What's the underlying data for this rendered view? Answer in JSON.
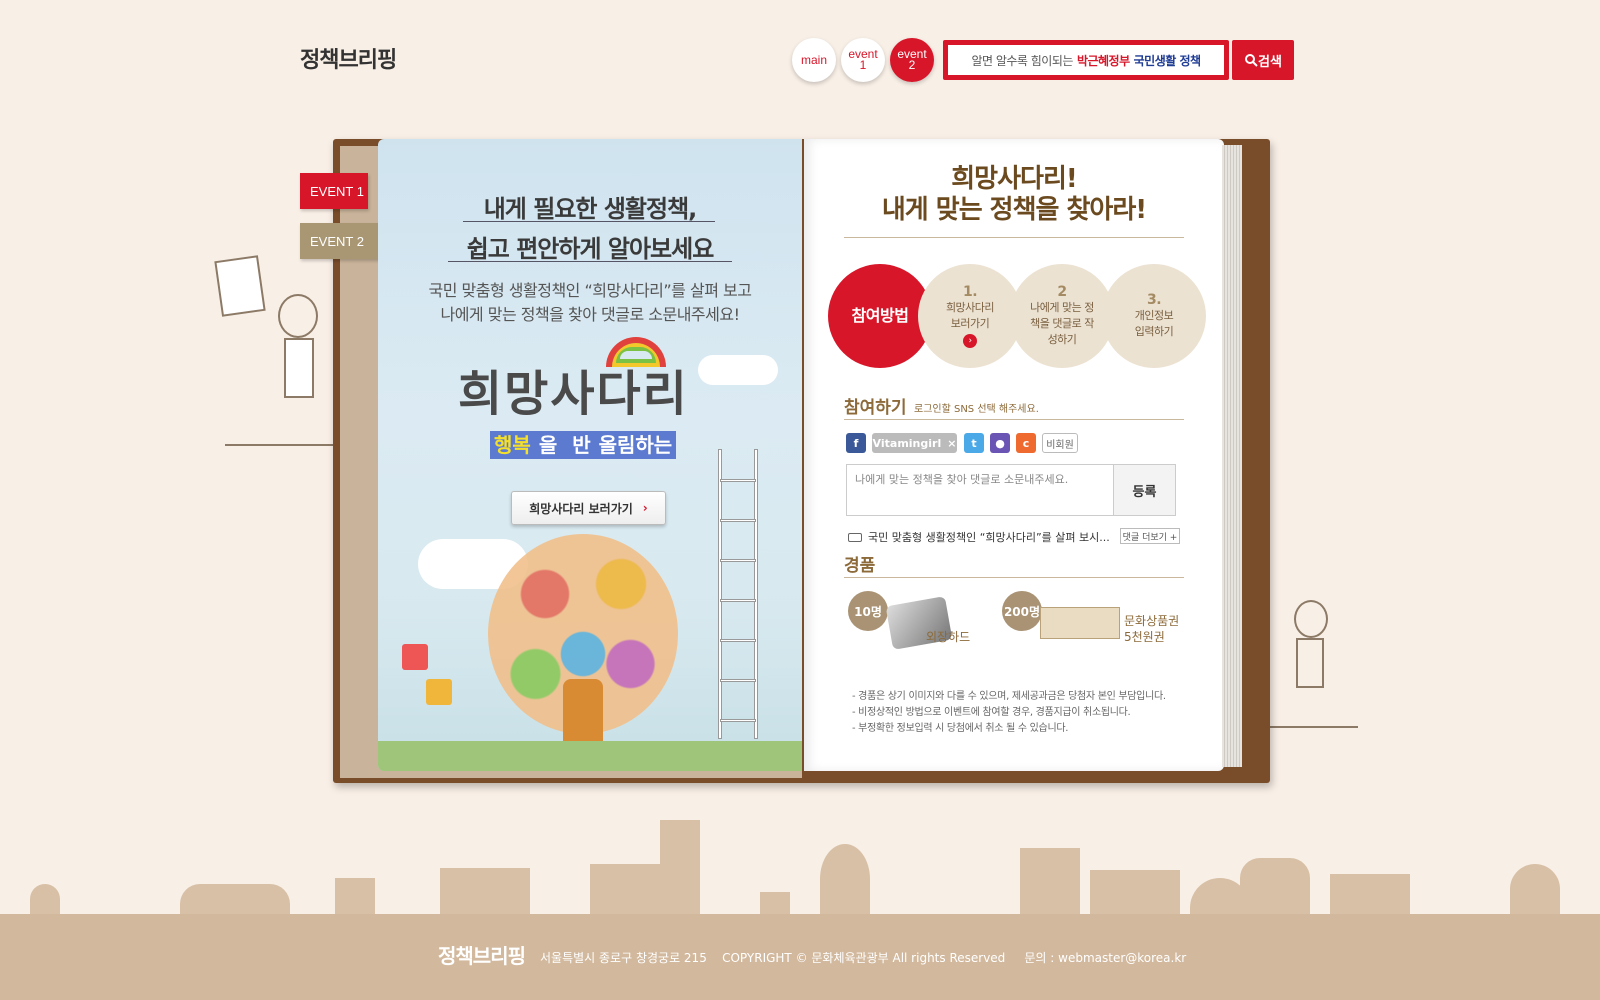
{
  "header": {
    "logo": "정책브리핑",
    "nav": [
      {
        "label": "main",
        "active": false
      },
      {
        "label": "event 1",
        "active": false
      },
      {
        "label": "event 2",
        "active": true
      }
    ],
    "search": {
      "prefix": "알면 알수록 힘이되는",
      "highlight_red": "박근혜정부",
      "highlight_blue": "국민생활 정책",
      "button_label": "검색"
    }
  },
  "side_tabs": [
    {
      "label": "EVENT 1",
      "color": "#d7162a"
    },
    {
      "label": "EVENT 2",
      "color": "#a99774"
    }
  ],
  "left_page": {
    "title_line1": "내게 필요한 생활정책,",
    "title_line2": "쉽고 편안하게 알아보세요",
    "desc_line1": "국민 맞춤형 생활정책인 “희망사다리”를 살펴 보고",
    "desc_line2": "나에게 맞는 정책을 찾아 댓글로 소문내주세요!",
    "brand_title": "희망사다리",
    "brand_sub_1": "행복",
    "brand_sub_2": "을 ",
    "brand_sub_3": "반",
    "brand_sub_4": "올림하는",
    "view_button": "희망사다리 보러가기"
  },
  "right_page": {
    "title_line1": "희망사다리!",
    "title_line2": "내게 맞는 정책을 찾아라!",
    "steps": [
      {
        "num": "",
        "label": "참여방법"
      },
      {
        "num": "1.",
        "label": "희망사다리 보러가기"
      },
      {
        "num": "2",
        "label": "나에게 맞는 정책을 댓글로 작성하기"
      },
      {
        "num": "3.",
        "label": "개인정보 입력하기"
      }
    ],
    "participate": {
      "title": "참여하기",
      "note": "로그인할 SNS 선택 해주세요.",
      "sns_user": "Vitamingirl",
      "guest_label": "비회원",
      "comment_placeholder": "나에게 맞는 정책을 찾아 댓글로 소문내주세요.",
      "submit_label": "등록",
      "latest_comment": "국민 맞춤형 생활정책인 “희망사다리”를 살펴 보시...",
      "more_label": "댓글 더보기 +"
    },
    "prizes": {
      "title": "경품",
      "items": [
        {
          "count": "10명",
          "name": "외장하드"
        },
        {
          "count": "200명",
          "name": "문화상품권 5천원권"
        }
      ],
      "notes": [
        "- 경품은 상기 이미지와 다를 수 있으며, 제세공과금은 당첨자 본인 부담입니다.",
        "- 비정상적인 방법으로 이벤트에 참여할 경우, 경품지급이 취소됩니다.",
        "- 부정확한 정보입력 시 당첨에서 취소 될 수 있습니다."
      ]
    }
  },
  "footer": {
    "logo": "정책브리핑",
    "address": "서울특별시 종로구 창경궁로 215",
    "copyright": "COPYRIGHT © 문화체육관광부 All rights Reserved",
    "contact": "문의 : webmaster@korea.kr"
  },
  "colors": {
    "accent_red": "#d7162a",
    "tan": "#a99774",
    "background": "#f8efe6",
    "footer_bg": "#d2b89d"
  },
  "icons": [
    "search-icon",
    "chevron-right-icon",
    "facebook-icon",
    "twitter-icon",
    "me2day-icon",
    "cyworld-icon",
    "comment-icon",
    "close-icon"
  ]
}
